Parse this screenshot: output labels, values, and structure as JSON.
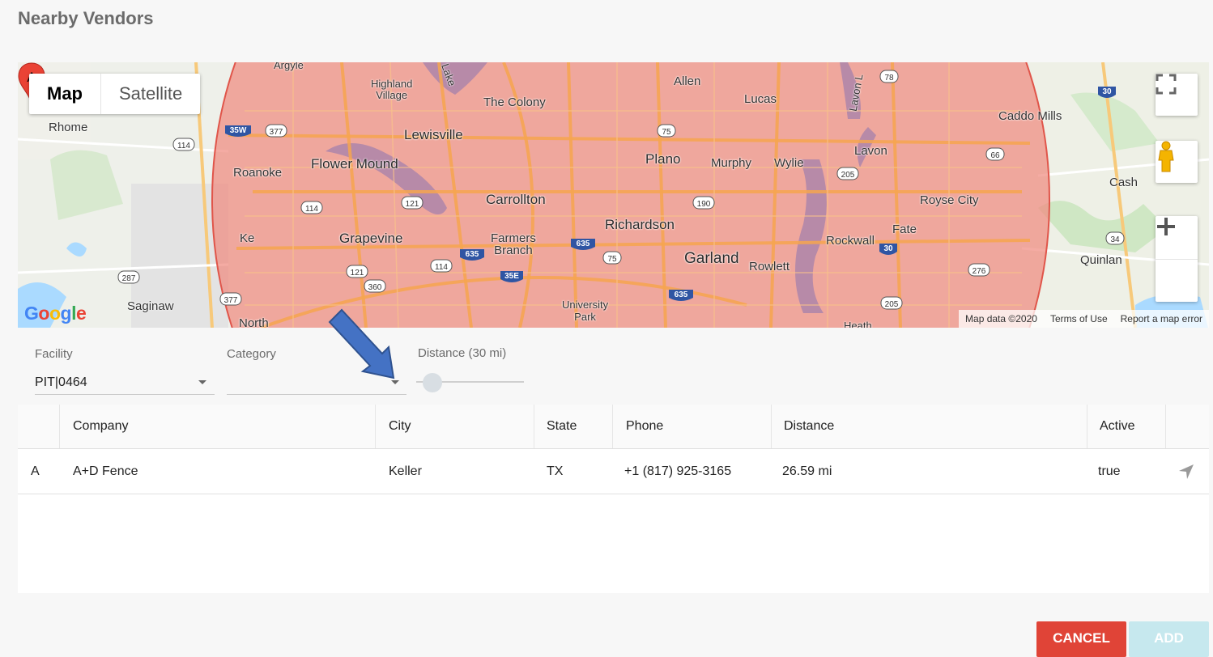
{
  "dialog": {
    "title": "Nearby Vendors"
  },
  "map": {
    "type_buttons": [
      "Map",
      "Satellite"
    ],
    "active_type": "Map",
    "radius_color": "#f08a80",
    "marker_label": "A",
    "logo": "Google",
    "attribution": {
      "data": "Map data ©2020",
      "terms": "Terms of Use",
      "report": "Report a map error"
    },
    "controls": [
      "fullscreen-icon",
      "pegman-icon",
      "zoom-in-icon",
      "zoom-out-icon"
    ],
    "labels": {
      "argyle": "Argyle",
      "highland_village": "Highland\nVillage",
      "the_colony": "The Colony",
      "allen": "Allen",
      "lucas": "Lucas",
      "lavon_lake": "Lavon L",
      "caddo_mills": "Caddo Mills",
      "rhome": "Rhome",
      "lewisville": "Lewisville",
      "flower_mound": "Flower Mound",
      "plano": "Plano",
      "murphy": "Murphy",
      "wylie": "Wylie",
      "lavon": "Lavon",
      "roanoke": "Roanoke",
      "carrollton": "Carrollton",
      "royse_city": "Royse City",
      "cash": "Cash",
      "richardson": "Richardson",
      "grapevine": "Grapevine",
      "farmers_branch": "Farmers\nBranch",
      "fate": "Fate",
      "rockwall": "Rockwall",
      "garland": "Garland",
      "rowlett": "Rowlett",
      "quinlan": "Quinlan",
      "saginaw": "Saginaw",
      "university_park": "University\nPark",
      "north": "North",
      "heath": "Heath",
      "ke": "Ke",
      "lake": "Lake"
    },
    "shields": [
      "35W",
      "377",
      "114",
      "121",
      "75",
      "190",
      "205",
      "66",
      "78",
      "30",
      "635",
      "35E",
      "360",
      "287",
      "34",
      "276"
    ]
  },
  "filters": {
    "facility": {
      "label": "Facility",
      "value": "PIT|0464"
    },
    "category": {
      "label": "Category",
      "value": ""
    },
    "distance": {
      "label": "Distance (30 mi)",
      "value": 30
    }
  },
  "table": {
    "columns": [
      "",
      "Company",
      "City",
      "State",
      "Phone",
      "Distance",
      "Active",
      ""
    ],
    "rows": [
      {
        "marker": "A",
        "company": "A+D Fence",
        "city": "Keller",
        "state": "TX",
        "phone": "+1 (817) 925-3165",
        "distance": "26.59 mi",
        "active": "true",
        "action_icon": "navigate-icon"
      }
    ]
  },
  "actions": {
    "cancel": "CANCEL",
    "add": "ADD"
  },
  "colors": {
    "cancel": "#e04437",
    "add_disabled": "#c6e8ee",
    "annotation_arrow": "#4472c4"
  }
}
